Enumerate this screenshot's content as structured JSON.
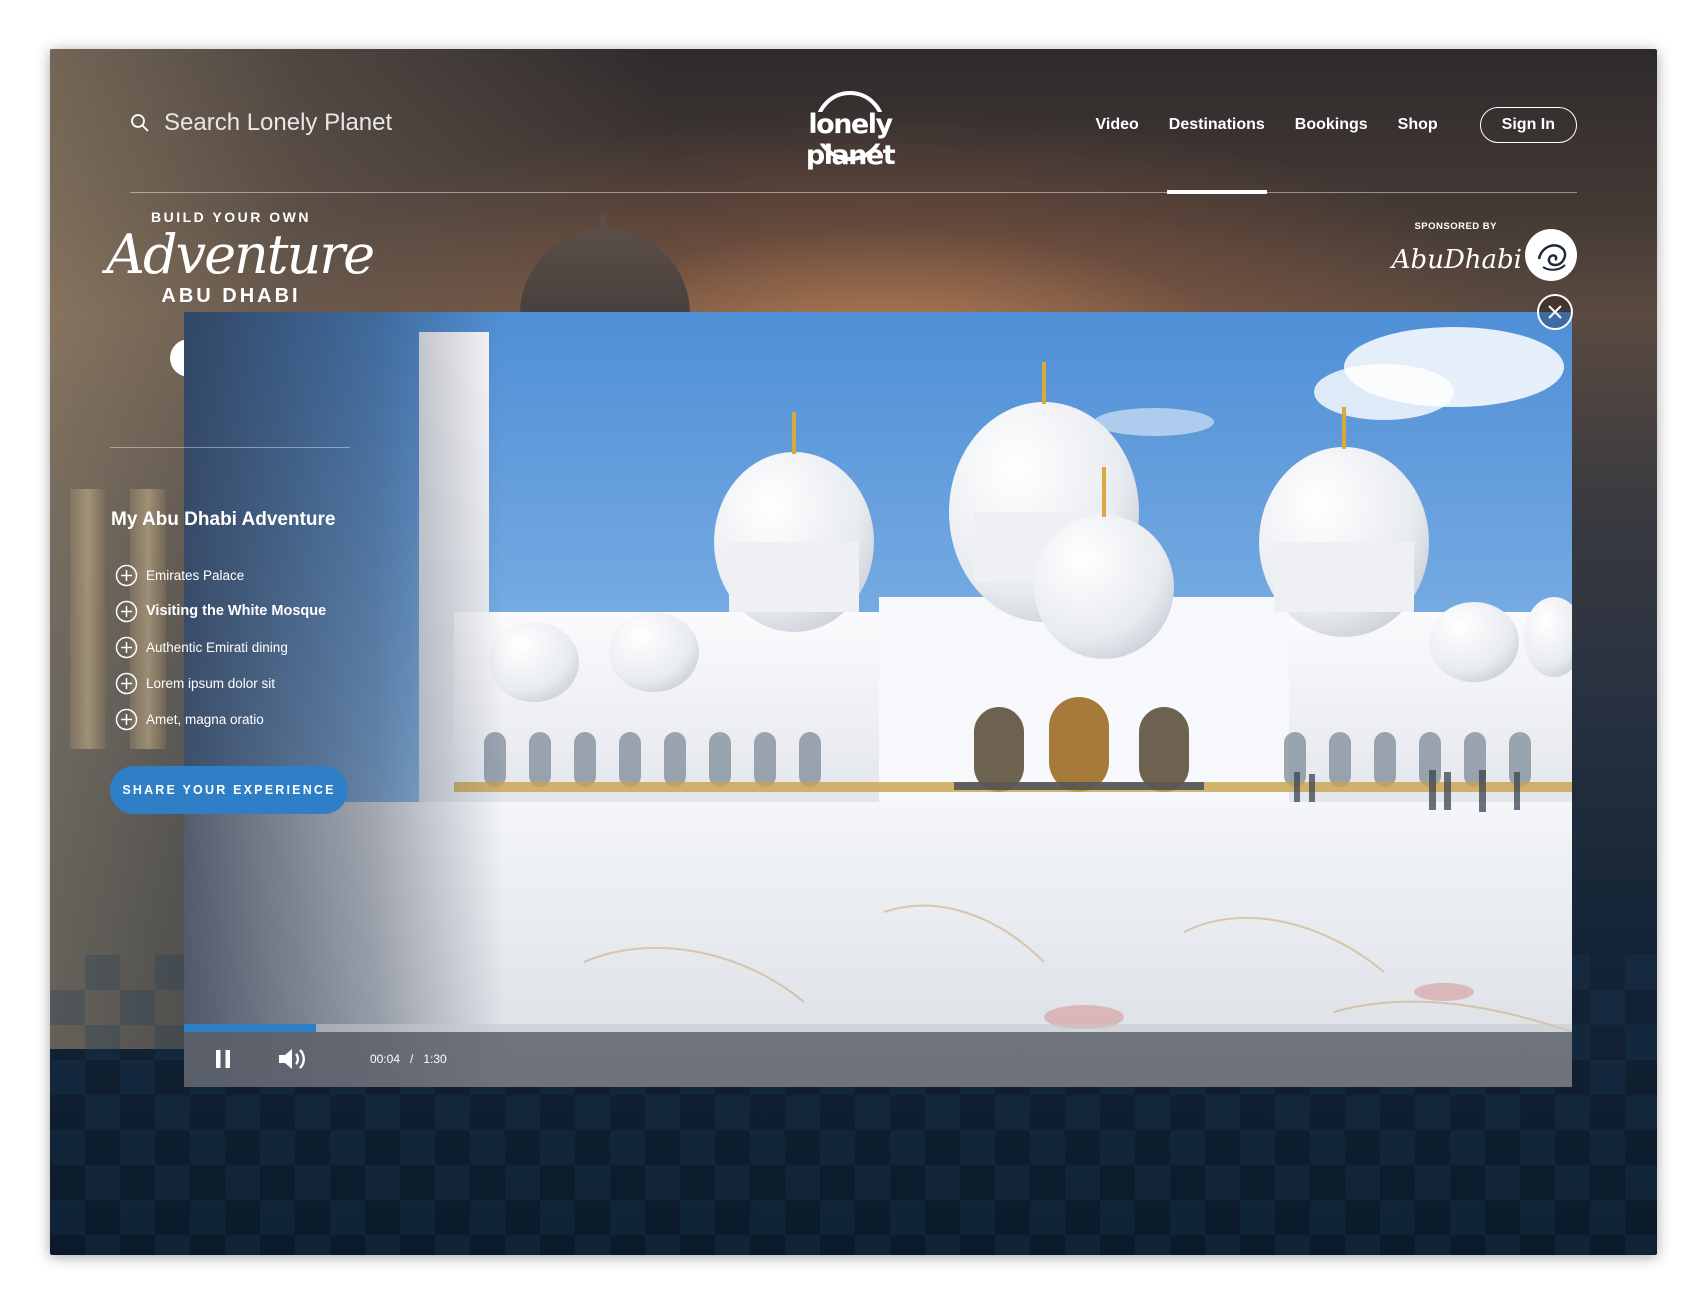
{
  "header": {
    "search_placeholder": "Search Lonely Planet",
    "logo_text": "lonely planet",
    "nav": [
      {
        "label": "Video",
        "active": false
      },
      {
        "label": "Destinations",
        "active": true
      },
      {
        "label": "Bookings",
        "active": false
      },
      {
        "label": "Shop",
        "active": false
      }
    ],
    "signin_label": "Sign In"
  },
  "brand": {
    "top": "BUILD YOUR OWN",
    "script": "Adventure",
    "bottom": "ABU DHABI"
  },
  "social": [
    "facebook-icon",
    "instagram-icon",
    "twitter-icon"
  ],
  "sponsor": {
    "label": "SPONSORED BY",
    "logo": "AbuDhabi"
  },
  "adventure": {
    "title": "My Abu Dhabi Adventure",
    "items": [
      {
        "label": "Emirates Palace",
        "active": false
      },
      {
        "label": "Visiting the White Mosque",
        "active": true
      },
      {
        "label": "Authentic Emirati dining",
        "active": false
      },
      {
        "label": "Lorem ipsum dolor sit",
        "active": false
      },
      {
        "label": "Amet, magna oratio",
        "active": false
      }
    ],
    "share_label": "SHARE YOUR EXPERIENCE"
  },
  "video": {
    "current_time": "00:04",
    "separator": "/",
    "duration": "1:30",
    "progress": 0.095
  },
  "colors": {
    "accent": "#2f7fc6",
    "sky": "#6ea6e0",
    "marble": "#f2f4f7"
  }
}
